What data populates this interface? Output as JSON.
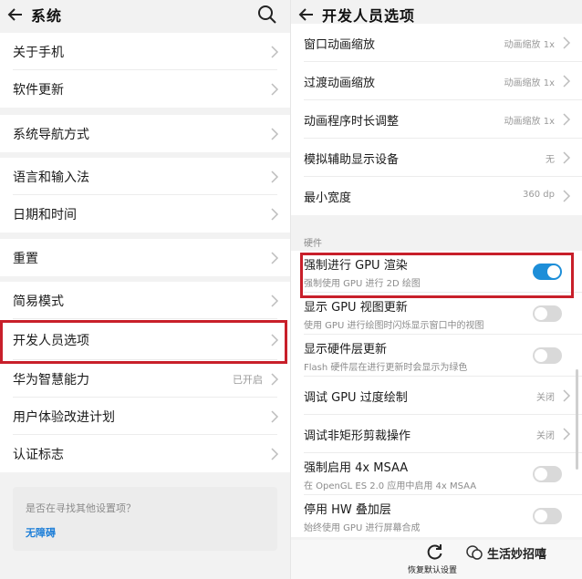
{
  "left": {
    "title": "系统",
    "items": [
      {
        "label": "关于手机"
      },
      {
        "label": "软件更新"
      },
      {
        "label": "系统导航方式"
      },
      {
        "label": "语言和输入法"
      },
      {
        "label": "日期和时间"
      },
      {
        "label": "重置"
      },
      {
        "label": "简易模式"
      },
      {
        "label": "开发人员选项"
      },
      {
        "label": "华为智慧能力",
        "value": "已开启"
      },
      {
        "label": "用户体验改进计划"
      },
      {
        "label": "认证标志"
      }
    ],
    "hint": {
      "question": "是否在寻找其他设置项？",
      "link": "无障碍"
    }
  },
  "right": {
    "title": "开发人员选项",
    "items": [
      {
        "label": "窗口动画缩放",
        "value": "动画缩放 1x"
      },
      {
        "label": "过渡动画缩放",
        "value": "动画缩放 1x"
      },
      {
        "label": "动画程序时长调整",
        "value": "动画缩放 1x"
      },
      {
        "label": "模拟辅助显示设备",
        "value": "无"
      },
      {
        "label": "最小宽度",
        "value": "360 dp"
      }
    ],
    "section": "硬件",
    "hw": [
      {
        "label": "强制进行 GPU 渲染",
        "sub": "强制使用 GPU 进行 2D 绘图",
        "toggle": true
      },
      {
        "label": "显示 GPU 视图更新",
        "sub": "使用 GPU 进行绘图时闪烁显示窗口中的视图",
        "toggle": false
      },
      {
        "label": "显示硬件层更新",
        "sub": "Flash 硬件层在进行更新时会显示为绿色",
        "toggle": false
      },
      {
        "label": "调试 GPU 过度绘制",
        "value": "关闭"
      },
      {
        "label": "调试非矩形剪裁操作",
        "value": "关闭"
      },
      {
        "label": "强制启用 4x MSAA",
        "sub": "在 OpenGL ES 2.0 应用中启用 4x MSAA",
        "toggle": false
      },
      {
        "label": "停用 HW 叠加层",
        "sub": "始终使用 GPU 进行屏幕合成",
        "toggle": false
      }
    ],
    "reset_label": "恢复默认设置"
  },
  "watermark": "生活妙招嘻",
  "colors": {
    "accent": "#1d8ed8",
    "highlight": "#c81f2a",
    "link": "#1f7fd8"
  }
}
